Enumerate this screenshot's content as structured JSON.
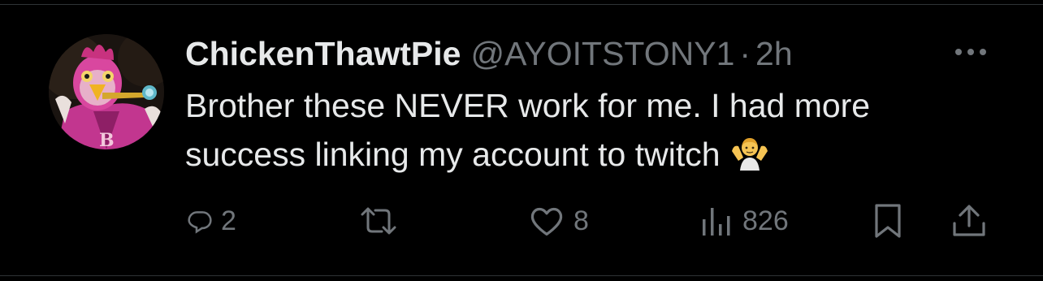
{
  "tweet": {
    "display_name": "ChickenThawtPie",
    "handle": "@AYOITSTONY1",
    "separator": "·",
    "time": "2h",
    "text_line1": "Brother these NEVER work for me. I had more",
    "text_line2": "success  linking my account to twitch",
    "emoji": "person-shrugging-emoji"
  },
  "actions": {
    "reply_count": "2",
    "repost_count": "",
    "like_count": "8",
    "views_count": "826"
  },
  "icons": {
    "more": "more-horizontal-icon",
    "reply": "reply-icon",
    "repost": "repost-icon",
    "like": "heart-icon",
    "views": "views-bar-chart-icon",
    "bookmark": "bookmark-icon",
    "share": "share-icon"
  },
  "colors": {
    "background": "#000000",
    "primary_text": "#e7e9ea",
    "secondary_text": "#71767b",
    "divider": "#2f3336"
  }
}
